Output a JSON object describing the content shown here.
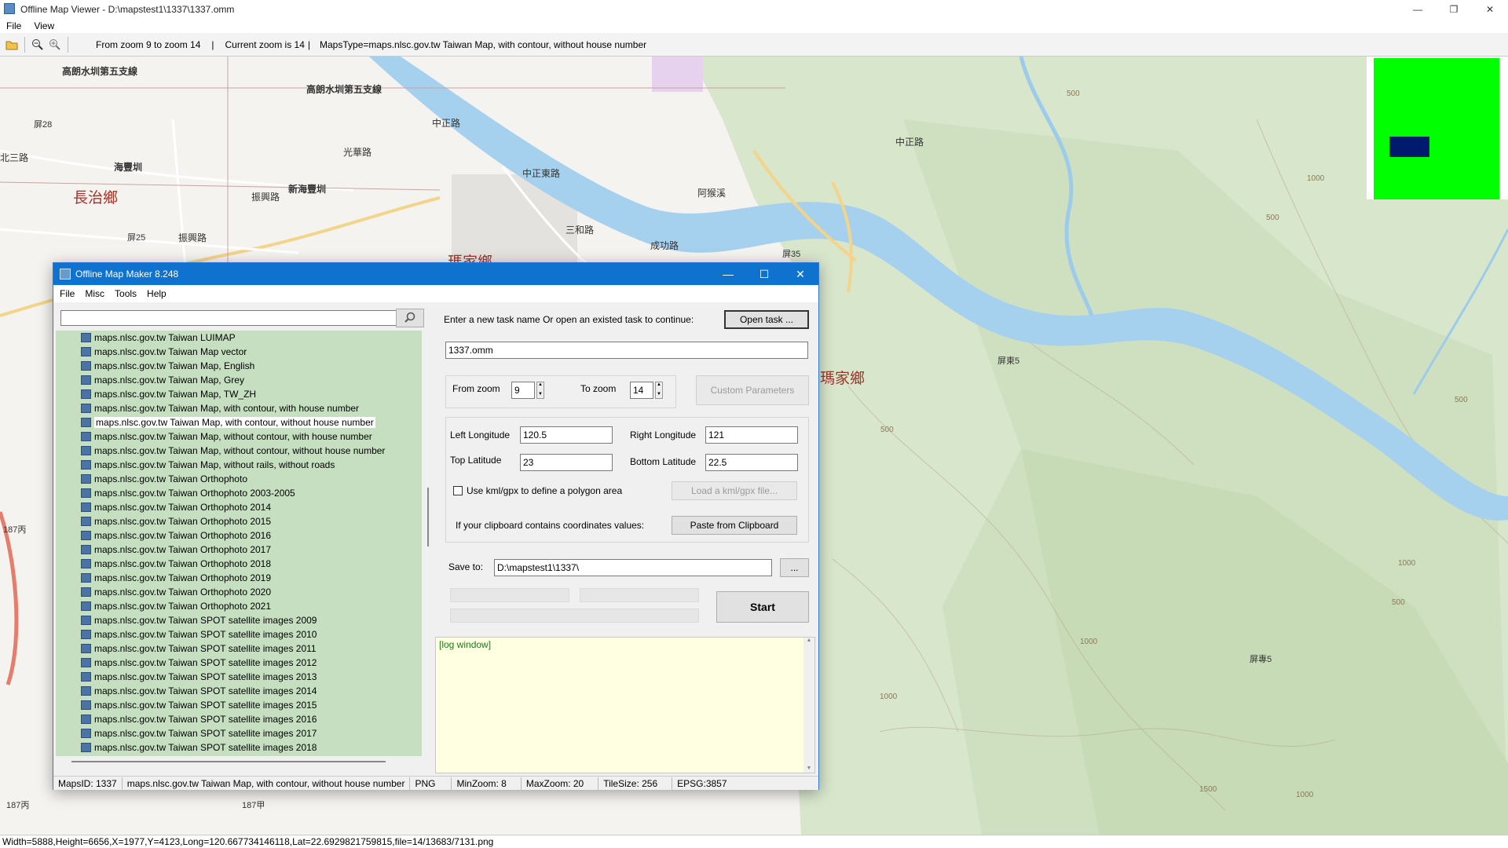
{
  "viewer": {
    "title": "Offline Map Viewer - D:\\mapstest1\\1337\\1337.omm",
    "menu": [
      "File",
      "View"
    ],
    "toolbar": {
      "zoom_range": "From zoom 9 to zoom 14",
      "current_zoom": "Current zoom is 14",
      "maps_type": "MapsType=maps.nlsc.gov.tw Taiwan Map, with contour, without house number",
      "separator": "|"
    },
    "status": "Width=5888,Height=6656,X=1977,Y=4123,Long=120.667734146118,Lat=22.6929821759815,file=14/13683/7131.png",
    "minimap_colors": {
      "background": "#00ff00",
      "viewport": "#001a6e"
    }
  },
  "map": {
    "labels": [
      "高朗水圳第五支線",
      "高朗水圳第五支線",
      "屏28",
      "中正路",
      "北三路",
      "海豐圳",
      "長治鄉",
      "光華路",
      "新海豐圳",
      "振興路",
      "振興路",
      "屏25",
      "中正東路",
      "阿猴溪",
      "三和路",
      "成功路",
      "屏35",
      "中正路",
      "瑪家鄉",
      "瑪家鄉",
      "屏東5",
      "187丙",
      "187丙",
      "187甲",
      "屏專5",
      "500",
      "500",
      "500",
      "1000",
      "1000",
      "1000",
      "1000",
      "1000",
      "500",
      "500",
      "1500"
    ],
    "colors": {
      "river": "#a7d3ef",
      "terrain": "#dce9d2",
      "base": "#f4f3f0"
    }
  },
  "dialog": {
    "title": "Offline Map Maker 8.248",
    "menu": [
      "File",
      "Misc",
      "Tools",
      "Help"
    ],
    "search_value": "",
    "task_prompt": "Enter a new task name Or open an existed task to continue:",
    "open_task_label": "Open task ...",
    "task_name": "1337.omm",
    "from_zoom_label": "From zoom",
    "from_zoom_value": "9",
    "to_zoom_label": "To zoom",
    "to_zoom_value": "14",
    "custom_params_label": "Custom Parameters",
    "left_lon_label": "Left Longitude",
    "left_lon_value": "120.5",
    "right_lon_label": "Right Longitude",
    "right_lon_value": "121",
    "top_lat_label": "Top Latitude",
    "top_lat_value": "23",
    "bottom_lat_label": "Bottom Latitude",
    "bottom_lat_value": "22.5",
    "kml_label": "Use kml/gpx to define a polygon area",
    "kml_checked": false,
    "load_kml_label": "Load a kml/gpx file...",
    "clipboard_label": "If your clipboard contains coordinates values:",
    "paste_label": "Paste from Clipboard",
    "save_to_label": "Save to:",
    "save_to_value": "D:\\mapstest1\\1337\\",
    "browse_label": "...",
    "start_label": "Start",
    "log_header": "[log window]",
    "map_list": [
      "maps.nlsc.gov.tw Taiwan LUIMAP",
      "maps.nlsc.gov.tw Taiwan Map vector",
      "maps.nlsc.gov.tw Taiwan Map, English",
      "maps.nlsc.gov.tw Taiwan Map, Grey",
      "maps.nlsc.gov.tw Taiwan Map, TW_ZH",
      "maps.nlsc.gov.tw Taiwan Map, with contour, with house number",
      "maps.nlsc.gov.tw Taiwan Map, with contour, without house number",
      "maps.nlsc.gov.tw Taiwan Map, without contour, with house number",
      "maps.nlsc.gov.tw Taiwan Map, without contour, without house number",
      "maps.nlsc.gov.tw Taiwan Map, without rails, without roads",
      "maps.nlsc.gov.tw Taiwan Orthophoto",
      "maps.nlsc.gov.tw Taiwan Orthophoto 2003-2005",
      "maps.nlsc.gov.tw Taiwan Orthophoto 2014",
      "maps.nlsc.gov.tw Taiwan Orthophoto 2015",
      "maps.nlsc.gov.tw Taiwan Orthophoto 2016",
      "maps.nlsc.gov.tw Taiwan Orthophoto 2017",
      "maps.nlsc.gov.tw Taiwan Orthophoto 2018",
      "maps.nlsc.gov.tw Taiwan Orthophoto 2019",
      "maps.nlsc.gov.tw Taiwan Orthophoto 2020",
      "maps.nlsc.gov.tw Taiwan Orthophoto 2021",
      "maps.nlsc.gov.tw Taiwan SPOT satellite images 2009",
      "maps.nlsc.gov.tw Taiwan SPOT satellite images 2010",
      "maps.nlsc.gov.tw Taiwan SPOT satellite images 2011",
      "maps.nlsc.gov.tw Taiwan SPOT satellite images 2012",
      "maps.nlsc.gov.tw Taiwan SPOT satellite images 2013",
      "maps.nlsc.gov.tw Taiwan SPOT satellite images 2014",
      "maps.nlsc.gov.tw Taiwan SPOT satellite images 2015",
      "maps.nlsc.gov.tw Taiwan SPOT satellite images 2016",
      "maps.nlsc.gov.tw Taiwan SPOT satellite images 2017",
      "maps.nlsc.gov.tw Taiwan SPOT satellite images 2018"
    ],
    "selected_index": 6,
    "status": {
      "maps_id": "MapsID: 1337",
      "map_name": "maps.nlsc.gov.tw Taiwan Map, with contour, without house number",
      "format": "PNG",
      "min_zoom": "MinZoom: 8",
      "max_zoom": "MaxZoom: 20",
      "tile_size": "TileSize: 256",
      "epsg": "EPSG:3857"
    }
  }
}
